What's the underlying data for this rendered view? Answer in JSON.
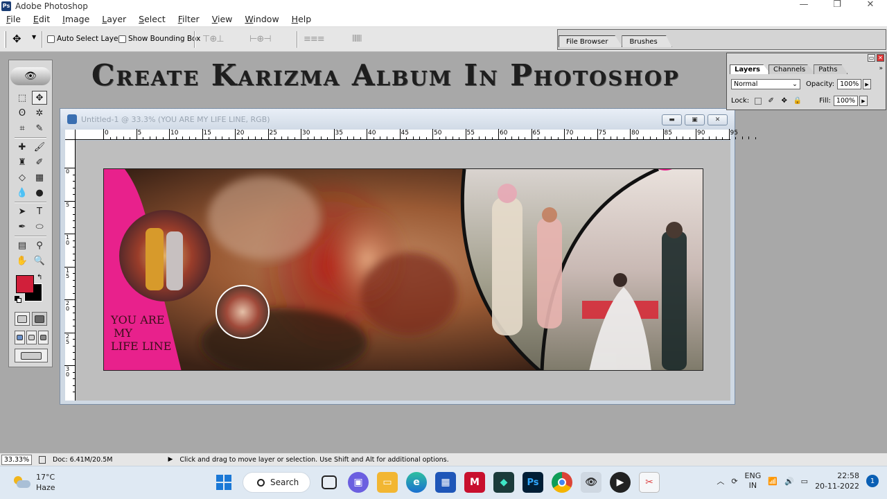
{
  "app": {
    "title": "Adobe Photoshop",
    "icon_label": "Ps",
    "window_controls": [
      "—",
      "❐",
      "✕"
    ]
  },
  "menu": [
    "File",
    "Edit",
    "Image",
    "Layer",
    "Select",
    "Filter",
    "View",
    "Window",
    "Help"
  ],
  "options_bar": {
    "auto_select_label": "Auto Select Layer",
    "auto_select_checked": false,
    "show_bounding_box_label": "Show Bounding Box",
    "show_bounding_box_checked": false,
    "align_group_1": "⊤⊕⊥",
    "align_group_2": "⊢⊕⊣",
    "distribute_group_1": "≡≡≡",
    "distribute_group_2": "⫴⫴⫴"
  },
  "palette_well_tabs": [
    "File Browser",
    "Brushes"
  ],
  "banner": {
    "text": "Create Karizma Album In Photoshop"
  },
  "document": {
    "title": "Untitled-1 @ 33.3% (YOU ARE  MY  LIFE LINE, RGB)",
    "ruler_top": [
      "0",
      "5",
      "10",
      "15",
      "20",
      "25",
      "30",
      "35",
      "40",
      "45",
      "50",
      "55",
      "60",
      "65",
      "70",
      "75",
      "80",
      "85",
      "90",
      "95"
    ],
    "ruler_left": [
      "0",
      "5",
      "10",
      "15",
      "20",
      "25",
      "30"
    ],
    "album_text": [
      "YOU ARE",
      "MY",
      "LIFE LINE"
    ]
  },
  "status": {
    "zoom": "33.33%",
    "doc_info": "Doc: 6.41M/20.5M",
    "message": "Click and drag to move layer or selection.  Use Shift and Alt for additional options."
  },
  "layers_panel": {
    "tabs": [
      "Layers",
      "Channels",
      "Paths"
    ],
    "active_tab": "Layers",
    "blend_mode": "Normal",
    "opacity_label": "Opacity:",
    "opacity_value": "100%",
    "lock_label": "Lock:",
    "fill_label": "Fill:",
    "fill_value": "100%"
  },
  "taskbar": {
    "weather_temp": "17°C",
    "weather_desc": "Haze",
    "search_label": "Search",
    "app_icon_ps": "Ps",
    "lang_1": "ENG",
    "lang_2": "IN",
    "time": "22:58",
    "date": "20-11-2022",
    "notifications": "1"
  },
  "colors": {
    "foreground": "#d11f3a",
    "background": "#000000",
    "album_pink": "#e8218c"
  }
}
